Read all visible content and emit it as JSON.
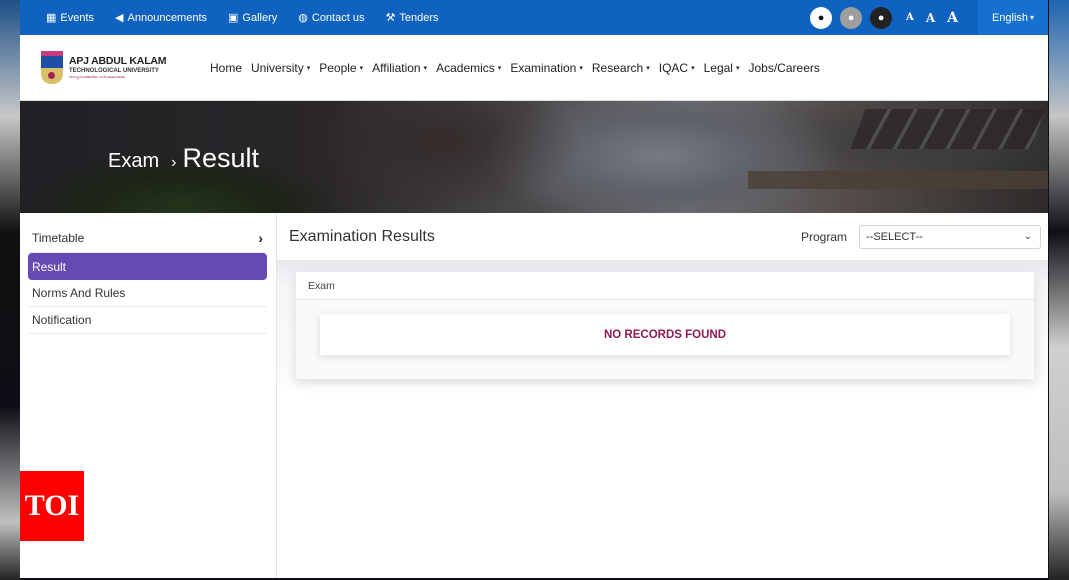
{
  "topbar": {
    "links": [
      {
        "label": "Events",
        "icon": "calendar-icon",
        "glyph": "▦"
      },
      {
        "label": "Announcements",
        "icon": "megaphone-icon",
        "glyph": "📢"
      },
      {
        "label": "Gallery",
        "icon": "image-icon",
        "glyph": "▣"
      },
      {
        "label": "Contact us",
        "icon": "globe-icon",
        "glyph": "◍"
      },
      {
        "label": "Tenders",
        "icon": "gavel-icon",
        "glyph": "⚒"
      }
    ],
    "contrast_icons": [
      "contrast-default-icon",
      "contrast-grey-icon",
      "contrast-dark-icon"
    ],
    "drop_glyph": "💧",
    "font_sizes": [
      "A",
      "A",
      "A"
    ],
    "language": "English",
    "caret": "▾",
    "color": "#0f62bf"
  },
  "logo": {
    "line1": "APJ ABDUL KALAM",
    "line2": "TECHNOLOGICAL UNIVERSITY",
    "line3": "ശാസ്ത്രസാങ്കേതിക സർവകലാശാല"
  },
  "nav": {
    "items": [
      {
        "label": "Home",
        "dropdown": false
      },
      {
        "label": "University",
        "dropdown": true
      },
      {
        "label": "People",
        "dropdown": true
      },
      {
        "label": "Affiliation",
        "dropdown": true
      },
      {
        "label": "Academics",
        "dropdown": true
      },
      {
        "label": "Examination",
        "dropdown": true
      },
      {
        "label": "Research",
        "dropdown": true
      },
      {
        "label": "IQAC",
        "dropdown": true
      },
      {
        "label": "Legal",
        "dropdown": true
      },
      {
        "label": "Jobs/Careers",
        "dropdown": false
      }
    ]
  },
  "hero": {
    "breadcrumb_parent": "Exam",
    "separator": "›",
    "breadcrumb_current": "Result"
  },
  "sidebar": {
    "items": [
      {
        "label": "Timetable",
        "has_chevron": true,
        "active": false
      },
      {
        "label": "Result",
        "has_chevron": false,
        "active": true
      },
      {
        "label": "Norms And Rules",
        "has_chevron": false,
        "active": false
      },
      {
        "label": "Notification",
        "has_chevron": false,
        "active": false
      }
    ],
    "chevron": "›",
    "active_color": "#6749b4"
  },
  "main": {
    "title": "Examination Results",
    "program_label": "Program",
    "program_select": {
      "selected": "--SELECT--",
      "chevron": "⌄"
    },
    "table_header": "Exam",
    "empty_message": "NO RECORDS FOUND",
    "empty_color": "#8e1b56"
  },
  "watermark": {
    "label": "TOI",
    "color": "#ff0000"
  }
}
